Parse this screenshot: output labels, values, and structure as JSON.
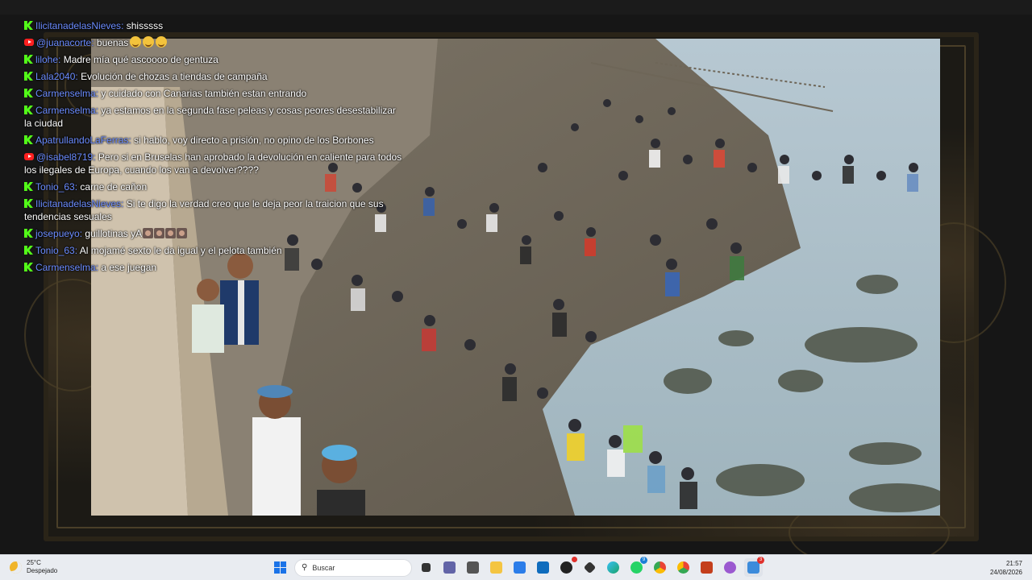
{
  "chat": {
    "messages": [
      {
        "platform": "kick",
        "user": "IlicitanadelasNieves",
        "text": "shisssss"
      },
      {
        "platform": "youtube",
        "user": "@juanacorte",
        "text": "buenas",
        "emojis": [
          "smile-emoji",
          "smile-emoji",
          "smile-emoji"
        ]
      },
      {
        "platform": "kick",
        "user": "lilohe",
        "text": "Madre mía qué ascoooo de gentuza"
      },
      {
        "platform": "kick",
        "user": "Lala2040",
        "text": "Evolución de chozas a tiendas de campaña"
      },
      {
        "platform": "kick",
        "user": "Carmenselma",
        "text": "y cuidado con Canarias también estan entrando"
      },
      {
        "platform": "kick",
        "user": "Carmenselma",
        "text": "ya estamos en la segunda fase peleas y cosas peores desestabilizar la ciudad"
      },
      {
        "platform": "kick",
        "user": "ApatrullandoLaFerras",
        "text": "si hablo, voy directo a prisión, no opino de los Borbones"
      },
      {
        "platform": "youtube",
        "user": "@isabel8719",
        "text": "Pero si en Bruselas han aprobado la devolución en caliente para todos los ilegales de Europa, cuando los van a devolver????"
      },
      {
        "platform": "kick",
        "user": "Tonio_63",
        "text": "carne de cañon"
      },
      {
        "platform": "kick",
        "user": "IlicitanadelasNieves",
        "text": "Si te digo la verdad creo que le deja peor la traicion que sus tendencias sesuales"
      },
      {
        "platform": "kick",
        "user": "josepueyo",
        "text": "guillotinas yA",
        "image_emotes": 4
      },
      {
        "platform": "kick",
        "user": "Tonio_63",
        "text": "Al mojamé sexto le da igual y el pelota también"
      },
      {
        "platform": "kick",
        "user": "Carmenselma",
        "text": "a ese juegan"
      }
    ]
  },
  "taskbar": {
    "weather": {
      "temp": "25°C",
      "condition": "Despejado",
      "icon": "moon-icon"
    },
    "search_placeholder": "Buscar",
    "clock": {
      "time": "21:57",
      "date": "24/08/2026"
    },
    "badges": {
      "app7": "",
      "whatsapp": "9",
      "teams": "3"
    }
  },
  "colors": {
    "username": "#6b8cff",
    "kick": "#53fc18",
    "youtube": "#ff2020"
  }
}
